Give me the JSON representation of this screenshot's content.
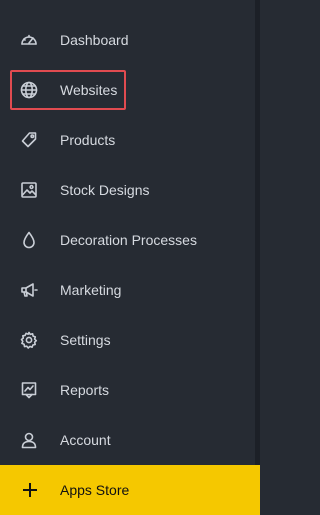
{
  "sidebar": {
    "items": [
      {
        "label": "Dashboard",
        "icon": "dashboard-gauge-icon"
      },
      {
        "label": "Websites",
        "icon": "globe-icon"
      },
      {
        "label": "Products",
        "icon": "tag-icon"
      },
      {
        "label": "Stock Designs",
        "icon": "image-icon"
      },
      {
        "label": "Decoration Processes",
        "icon": "droplet-icon"
      },
      {
        "label": "Marketing",
        "icon": "megaphone-icon"
      },
      {
        "label": "Settings",
        "icon": "gear-icon"
      },
      {
        "label": "Reports",
        "icon": "report-icon"
      },
      {
        "label": "Account",
        "icon": "user-icon"
      }
    ],
    "apps_store": {
      "label": "Apps Store",
      "icon": "plus-icon"
    }
  },
  "colors": {
    "background": "#262b33",
    "text": "#d6dae0",
    "highlight_border": "#e14b50",
    "apps_store_bg": "#f5c800"
  }
}
